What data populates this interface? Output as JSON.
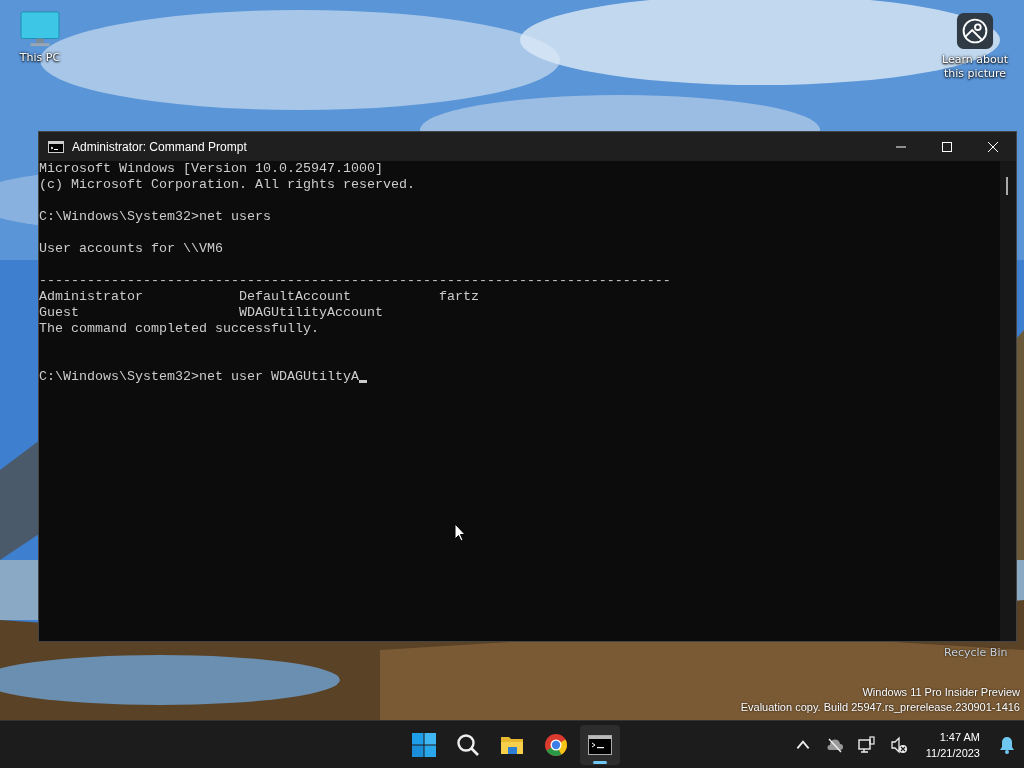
{
  "desktop": {
    "icons": [
      {
        "label": "This PC",
        "kind": "monitor"
      },
      {
        "label": "Learn about this picture",
        "kind": "info"
      }
    ],
    "recycle_bin": {
      "label": "Recycle Bin"
    },
    "watermark": [
      "Windows 11 Pro Insider Preview",
      "Evaluation copy. Build 25947.rs_prerelease.230901-1416"
    ]
  },
  "window": {
    "title": "Administrator: Command Prompt",
    "lines": [
      {
        "kind": "text",
        "text": "Microsoft Windows [Version 10.0.25947.1000]"
      },
      {
        "kind": "text",
        "text": "(c) Microsoft Corporation. All rights reserved."
      },
      {
        "kind": "blank"
      },
      {
        "kind": "text",
        "text": "C:\\Windows\\System32>net users"
      },
      {
        "kind": "blank"
      },
      {
        "kind": "text",
        "text": "User accounts for \\\\VM6"
      },
      {
        "kind": "blank"
      },
      {
        "kind": "text",
        "text": "-------------------------------------------------------------------------------"
      },
      {
        "kind": "text",
        "text": "Administrator            DefaultAccount           fartz"
      },
      {
        "kind": "text",
        "text": "Guest                    WDAGUtilityAccount"
      },
      {
        "kind": "text",
        "text": "The command completed successfully."
      },
      {
        "kind": "blank"
      },
      {
        "kind": "blank"
      },
      {
        "kind": "input",
        "text": "C:\\Windows\\System32>net user WDAGUtiltyA"
      }
    ]
  },
  "taskbar": {
    "apps": [
      {
        "kind": "start",
        "selected": false
      },
      {
        "kind": "search",
        "selected": false
      },
      {
        "kind": "folder",
        "selected": false
      },
      {
        "kind": "browser",
        "selected": false
      },
      {
        "kind": "terminal",
        "selected": true
      }
    ],
    "clock": {
      "time": "1:47 AM",
      "date": "11/21/2023"
    }
  }
}
